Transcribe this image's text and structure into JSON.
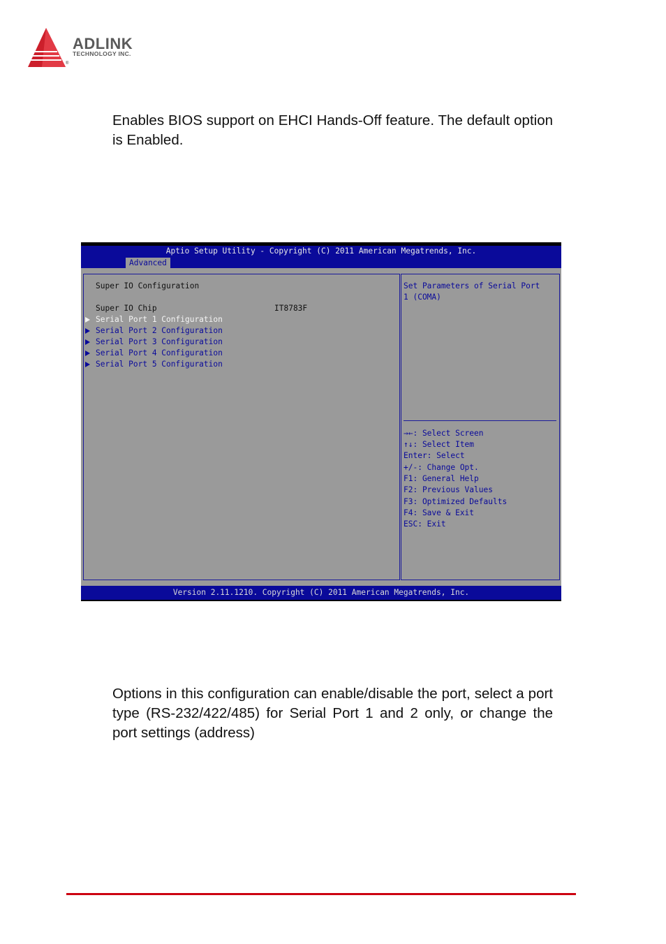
{
  "logo": {
    "brand": "ADLINK",
    "subtitle": "TECHNOLOGY INC.",
    "registered": "®",
    "icon": "adlink-triangle-logo",
    "brand_color": "#cc1f2b"
  },
  "paragraphs": {
    "intro": "Enables BIOS support on EHCI Hands-Off feature. The default option is Enabled.",
    "outro": "Options in this configuration can enable/disable the port, select a port type (RS-232/422/485) for Serial Port 1 and 2 only, or change the port settings (address)"
  },
  "bios": {
    "title": "Aptio Setup Utility - Copyright (C) 2011 American Megatrends, Inc.",
    "active_tab": "Advanced",
    "section_title": "Super IO Configuration",
    "chip_label": "Super IO Chip",
    "chip_value": "IT8783F",
    "menu_items": [
      {
        "label": "Serial Port 1 Configuration",
        "selected": true
      },
      {
        "label": "Serial Port 2 Configuration",
        "selected": false
      },
      {
        "label": "Serial Port 3 Configuration",
        "selected": false
      },
      {
        "label": "Serial Port 4 Configuration",
        "selected": false
      },
      {
        "label": "Serial Port 5 Configuration",
        "selected": false
      }
    ],
    "help_text": [
      "Set Parameters of Serial Port",
      "1 (COMA)"
    ],
    "key_help": [
      "→←: Select Screen",
      "↑↓: Select Item",
      "Enter: Select",
      "+/-: Change Opt.",
      "F1: General Help",
      "F2: Previous Values",
      "F3: Optimized Defaults",
      "F4: Save & Exit",
      "ESC: Exit"
    ],
    "footer": "Version 2.11.1210. Copyright (C) 2011 American Megatrends, Inc.",
    "colors": {
      "header_blue": "#0a0a9a",
      "panel_gray": "#9a9a9a",
      "selected_text": "#f4f4f4"
    }
  },
  "page": {
    "rule_color": "#cc0011"
  }
}
